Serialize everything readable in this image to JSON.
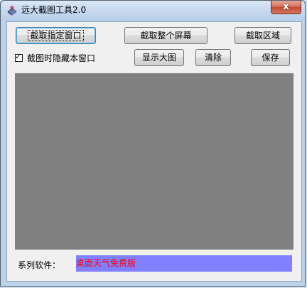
{
  "window": {
    "title": "远大截图工具2.0",
    "close_symbol": "x"
  },
  "toolbar": {
    "capture_window_label": "截取指定窗口",
    "capture_fullscreen_label": "截取整个屏幕",
    "capture_region_label": "截取区域",
    "show_large_label": "显示大图",
    "clear_label": "清除",
    "save_label": "保存"
  },
  "options": {
    "hide_window_label": "截图时隐藏本窗口",
    "hide_window_checked": true,
    "check_mark": "✓"
  },
  "footer": {
    "series_label": "系列软件：",
    "series_link_text": "桌面天气免费版"
  },
  "colors": {
    "preview_bg": "#808080",
    "link_bg": "#8080ff",
    "link_text": "#ff0000"
  },
  "icons": {
    "app": "app-icon",
    "close": "close-icon",
    "check": "check-icon"
  }
}
